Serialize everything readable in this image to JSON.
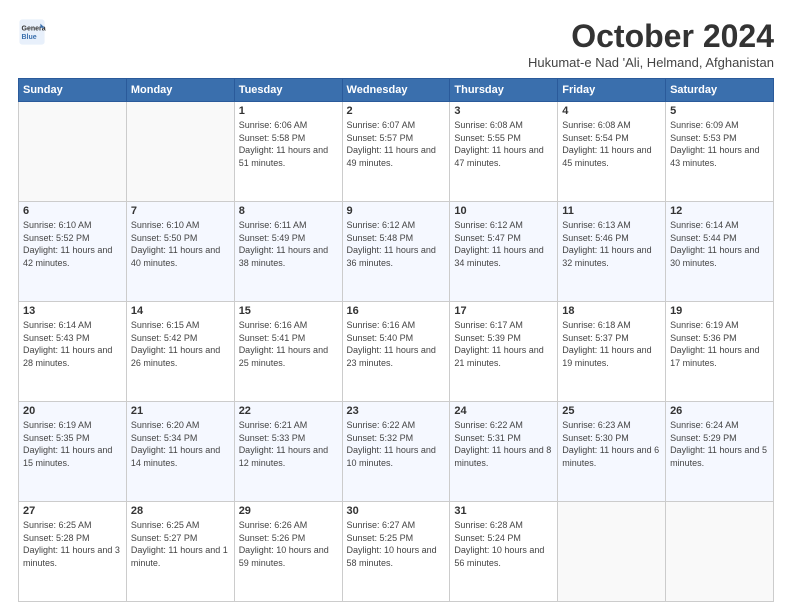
{
  "logo": {
    "line1": "General",
    "line2": "Blue"
  },
  "title": "October 2024",
  "subtitle": "Hukumat-e Nad 'Ali, Helmand, Afghanistan",
  "weekdays": [
    "Sunday",
    "Monday",
    "Tuesday",
    "Wednesday",
    "Thursday",
    "Friday",
    "Saturday"
  ],
  "weeks": [
    [
      {
        "day": "",
        "info": ""
      },
      {
        "day": "",
        "info": ""
      },
      {
        "day": "1",
        "info": "Sunrise: 6:06 AM\nSunset: 5:58 PM\nDaylight: 11 hours and 51 minutes."
      },
      {
        "day": "2",
        "info": "Sunrise: 6:07 AM\nSunset: 5:57 PM\nDaylight: 11 hours and 49 minutes."
      },
      {
        "day": "3",
        "info": "Sunrise: 6:08 AM\nSunset: 5:55 PM\nDaylight: 11 hours and 47 minutes."
      },
      {
        "day": "4",
        "info": "Sunrise: 6:08 AM\nSunset: 5:54 PM\nDaylight: 11 hours and 45 minutes."
      },
      {
        "day": "5",
        "info": "Sunrise: 6:09 AM\nSunset: 5:53 PM\nDaylight: 11 hours and 43 minutes."
      }
    ],
    [
      {
        "day": "6",
        "info": "Sunrise: 6:10 AM\nSunset: 5:52 PM\nDaylight: 11 hours and 42 minutes."
      },
      {
        "day": "7",
        "info": "Sunrise: 6:10 AM\nSunset: 5:50 PM\nDaylight: 11 hours and 40 minutes."
      },
      {
        "day": "8",
        "info": "Sunrise: 6:11 AM\nSunset: 5:49 PM\nDaylight: 11 hours and 38 minutes."
      },
      {
        "day": "9",
        "info": "Sunrise: 6:12 AM\nSunset: 5:48 PM\nDaylight: 11 hours and 36 minutes."
      },
      {
        "day": "10",
        "info": "Sunrise: 6:12 AM\nSunset: 5:47 PM\nDaylight: 11 hours and 34 minutes."
      },
      {
        "day": "11",
        "info": "Sunrise: 6:13 AM\nSunset: 5:46 PM\nDaylight: 11 hours and 32 minutes."
      },
      {
        "day": "12",
        "info": "Sunrise: 6:14 AM\nSunset: 5:44 PM\nDaylight: 11 hours and 30 minutes."
      }
    ],
    [
      {
        "day": "13",
        "info": "Sunrise: 6:14 AM\nSunset: 5:43 PM\nDaylight: 11 hours and 28 minutes."
      },
      {
        "day": "14",
        "info": "Sunrise: 6:15 AM\nSunset: 5:42 PM\nDaylight: 11 hours and 26 minutes."
      },
      {
        "day": "15",
        "info": "Sunrise: 6:16 AM\nSunset: 5:41 PM\nDaylight: 11 hours and 25 minutes."
      },
      {
        "day": "16",
        "info": "Sunrise: 6:16 AM\nSunset: 5:40 PM\nDaylight: 11 hours and 23 minutes."
      },
      {
        "day": "17",
        "info": "Sunrise: 6:17 AM\nSunset: 5:39 PM\nDaylight: 11 hours and 21 minutes."
      },
      {
        "day": "18",
        "info": "Sunrise: 6:18 AM\nSunset: 5:37 PM\nDaylight: 11 hours and 19 minutes."
      },
      {
        "day": "19",
        "info": "Sunrise: 6:19 AM\nSunset: 5:36 PM\nDaylight: 11 hours and 17 minutes."
      }
    ],
    [
      {
        "day": "20",
        "info": "Sunrise: 6:19 AM\nSunset: 5:35 PM\nDaylight: 11 hours and 15 minutes."
      },
      {
        "day": "21",
        "info": "Sunrise: 6:20 AM\nSunset: 5:34 PM\nDaylight: 11 hours and 14 minutes."
      },
      {
        "day": "22",
        "info": "Sunrise: 6:21 AM\nSunset: 5:33 PM\nDaylight: 11 hours and 12 minutes."
      },
      {
        "day": "23",
        "info": "Sunrise: 6:22 AM\nSunset: 5:32 PM\nDaylight: 11 hours and 10 minutes."
      },
      {
        "day": "24",
        "info": "Sunrise: 6:22 AM\nSunset: 5:31 PM\nDaylight: 11 hours and 8 minutes."
      },
      {
        "day": "25",
        "info": "Sunrise: 6:23 AM\nSunset: 5:30 PM\nDaylight: 11 hours and 6 minutes."
      },
      {
        "day": "26",
        "info": "Sunrise: 6:24 AM\nSunset: 5:29 PM\nDaylight: 11 hours and 5 minutes."
      }
    ],
    [
      {
        "day": "27",
        "info": "Sunrise: 6:25 AM\nSunset: 5:28 PM\nDaylight: 11 hours and 3 minutes."
      },
      {
        "day": "28",
        "info": "Sunrise: 6:25 AM\nSunset: 5:27 PM\nDaylight: 11 hours and 1 minute."
      },
      {
        "day": "29",
        "info": "Sunrise: 6:26 AM\nSunset: 5:26 PM\nDaylight: 10 hours and 59 minutes."
      },
      {
        "day": "30",
        "info": "Sunrise: 6:27 AM\nSunset: 5:25 PM\nDaylight: 10 hours and 58 minutes."
      },
      {
        "day": "31",
        "info": "Sunrise: 6:28 AM\nSunset: 5:24 PM\nDaylight: 10 hours and 56 minutes."
      },
      {
        "day": "",
        "info": ""
      },
      {
        "day": "",
        "info": ""
      }
    ]
  ]
}
